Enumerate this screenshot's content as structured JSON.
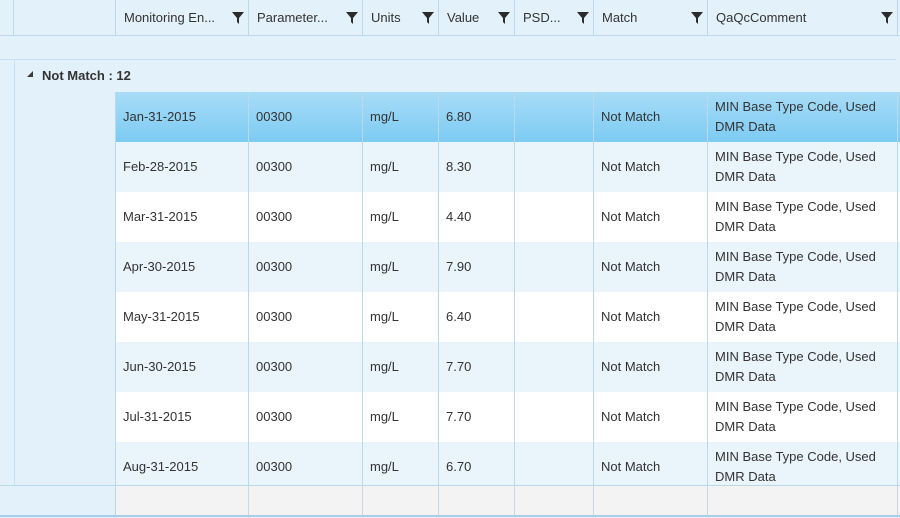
{
  "columns": [
    {
      "label": "Monitoring En...",
      "filter_icon": "filter-icon"
    },
    {
      "label": "Parameter...",
      "filter_icon": "filter-icon"
    },
    {
      "label": "Units",
      "filter_icon": "filter-icon"
    },
    {
      "label": "Value",
      "filter_icon": "filter-icon"
    },
    {
      "label": "PSD...",
      "filter_icon": "filter-icon"
    },
    {
      "label": "Match",
      "filter_icon": "filter-icon"
    },
    {
      "label": "QaQcComment",
      "filter_icon": "filter-icon"
    }
  ],
  "group": {
    "label": "Not Match : 12",
    "expander_icon": "triangle-expanded-icon"
  },
  "rows": [
    {
      "date": "Jan-31-2015",
      "parameter": "00300",
      "units": "mg/L",
      "value": "6.80",
      "psd": "",
      "match": "Not Match",
      "comment": "MIN Base Type Code, Used DMR Data",
      "selected": true
    },
    {
      "date": "Feb-28-2015",
      "parameter": "00300",
      "units": "mg/L",
      "value": "8.30",
      "psd": "",
      "match": "Not Match",
      "comment": "MIN Base Type Code, Used DMR Data"
    },
    {
      "date": "Mar-31-2015",
      "parameter": "00300",
      "units": "mg/L",
      "value": "4.40",
      "psd": "",
      "match": "Not Match",
      "comment": "MIN Base Type Code, Used DMR Data"
    },
    {
      "date": "Apr-30-2015",
      "parameter": "00300",
      "units": "mg/L",
      "value": "7.90",
      "psd": "",
      "match": "Not Match",
      "comment": "MIN Base Type Code, Used DMR Data"
    },
    {
      "date": "May-31-2015",
      "parameter": "00300",
      "units": "mg/L",
      "value": "6.40",
      "psd": "",
      "match": "Not Match",
      "comment": "MIN Base Type Code, Used DMR Data"
    },
    {
      "date": "Jun-30-2015",
      "parameter": "00300",
      "units": "mg/L",
      "value": "7.70",
      "psd": "",
      "match": "Not Match",
      "comment": "MIN Base Type Code, Used DMR Data"
    },
    {
      "date": "Jul-31-2015",
      "parameter": "00300",
      "units": "mg/L",
      "value": "7.70",
      "psd": "",
      "match": "Not Match",
      "comment": "MIN Base Type Code, Used DMR Data"
    },
    {
      "date": "Aug-31-2015",
      "parameter": "00300",
      "units": "mg/L",
      "value": "6.70",
      "psd": "",
      "match": "Not Match",
      "comment": "MIN Base Type Code, Used DMR Data"
    }
  ],
  "colors": {
    "header_bg": "#e3f1fa",
    "row_alt": "#e9f4fb",
    "row_selected": "#7ccbf3",
    "border": "#bcd9ec"
  }
}
